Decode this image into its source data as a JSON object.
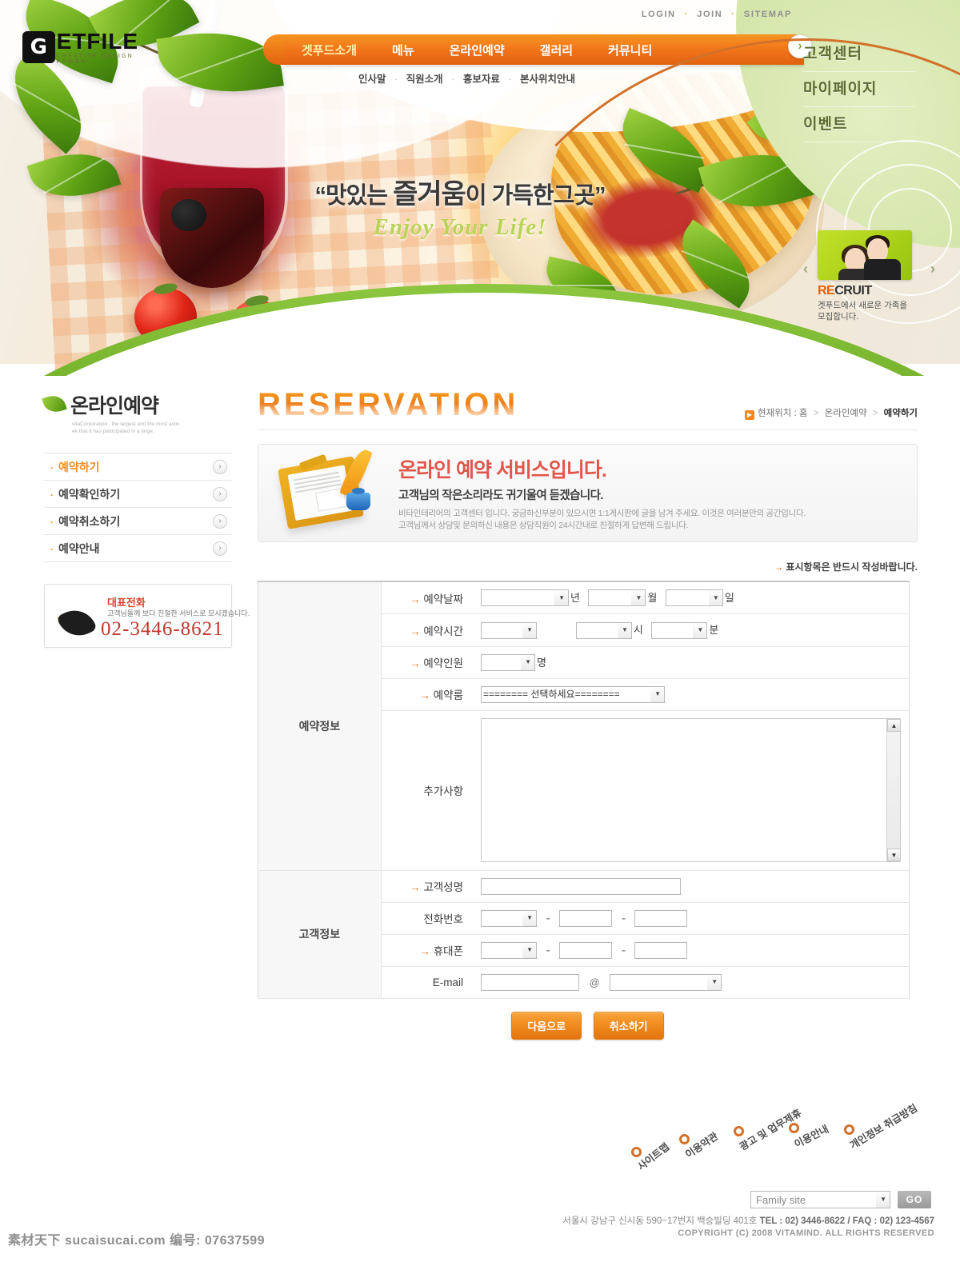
{
  "header": {
    "utility_links": [
      "LOGIN",
      "JOIN",
      "SITEMAP"
    ],
    "logo": {
      "mark": "G",
      "name": "ETFILE",
      "tagline": "CREATIVE DESIGN POWER"
    },
    "nav": [
      {
        "label": "겟푸드소개",
        "active": true
      },
      {
        "label": "메뉴",
        "active": false
      },
      {
        "label": "온라인예약",
        "active": false
      },
      {
        "label": "갤러리",
        "active": false
      },
      {
        "label": "커뮤니티",
        "active": false
      }
    ],
    "nav_arrow": "chevron-right-icon",
    "subnav": [
      "인사말",
      "직원소개",
      "홍보자료",
      "본사위치안내"
    ],
    "green_menu": [
      "고객센터",
      "마이페이지",
      "이벤트"
    ]
  },
  "hero": {
    "slogan_ko_pre": "“맛있는 ",
    "slogan_ko_em": "즐거움",
    "slogan_ko_post": "이 가득한그곳”",
    "slogan_en": "Enjoy Your Life!",
    "recruit": {
      "title_accent": "RE",
      "title_rest": "CRUIT",
      "desc_line1": "겟푸드에서 새로운 가족을",
      "desc_line2": "모집합니다.",
      "prev": "‹",
      "next": "›"
    }
  },
  "sidebar": {
    "title": "온라인예약",
    "subtitle_line1": "vitaCorporation , the largest and the most activ",
    "subtitle_line2": "ek that it has participated in a large.",
    "items": [
      {
        "label": "예약하기",
        "active": true
      },
      {
        "label": "예약확인하기",
        "active": false
      },
      {
        "label": "예약취소하기",
        "active": false
      },
      {
        "label": "예약안내",
        "active": false
      }
    ],
    "phone": {
      "title": "대표전화",
      "desc": "고객님들께 보다 친절한 서비스로 모시겠습니다.",
      "number": "02-3446-8621"
    }
  },
  "main": {
    "page_title": "RESERVATION",
    "breadcrumb": {
      "prefix": "현재위치 :",
      "home": "홈",
      "section": "온라인예약",
      "current": "예약하기",
      "sep": ">"
    },
    "infobox": {
      "heading": "온라인 예약 서비스입니다.",
      "subheading": "고객님의 작은소리라도 귀기울여 듣겠습니다.",
      "para_line1": "비타인테리어의 고객센터 입니다. 궁금하신부분이 있으시면 1:1게시판에 글을 남겨 주세요. 이것은 여러분만의 공간입니다.",
      "para_line2": "고객님께서 상담및 문의하신 내용은 상담직원이 24시간내로 친절하게 답변해 드립니다."
    },
    "required_note": "표시항목은 반드시 작성바랍니다.",
    "form": {
      "group_reservation": "예약정보",
      "group_customer": "고객정보",
      "rows": {
        "date": {
          "label": "예약날짜",
          "required": true,
          "unit_year": "년",
          "unit_month": "월",
          "unit_day": "일",
          "value_year": "",
          "value_month": "",
          "value_day": ""
        },
        "time": {
          "label": "예약시간",
          "required": true,
          "unit_hour": "시",
          "unit_minute": "분",
          "value_ampm": "",
          "value_hour": "",
          "value_minute": ""
        },
        "people": {
          "label": "예약인원",
          "required": true,
          "unit": "명",
          "value": ""
        },
        "room": {
          "label": "예약룸",
          "required": true,
          "value": "======== 선택하세요========"
        },
        "memo": {
          "label": "추가사항",
          "required": false,
          "value": ""
        },
        "name": {
          "label": "고객성명",
          "required": true,
          "value": ""
        },
        "tel": {
          "label": "전화번호",
          "required": false,
          "value_prefix": "",
          "value_mid": "",
          "value_last": "",
          "dash": "-"
        },
        "mobile": {
          "label": "휴대폰",
          "required": true,
          "value_prefix": "",
          "value_mid": "",
          "value_last": "",
          "dash": "-"
        },
        "email": {
          "label": "E-mail",
          "required": false,
          "value_id": "",
          "at": "@",
          "value_domain": ""
        }
      }
    },
    "buttons": {
      "next": "다음으로",
      "cancel": "취소하기"
    }
  },
  "footer": {
    "links": [
      "사이트맵",
      "이용약관",
      "광고 및 업무제휴",
      "이용안내",
      "개인정보 취급방침"
    ],
    "family_site": "Family site",
    "go": "GO",
    "address": "서울시  강남구 신시동 590~17번지  백승빌딩 401호",
    "tel": "TEL : 02) 3446-8622  /  FAQ : 02) 123-4567",
    "copyright": "COPYRIGHT (C) 2008 VITAMIND. ALL RIGHTS RESERVED",
    "watermark": "素材天下 sucaisucai.com  编号: 07637599"
  },
  "colors": {
    "orange": "#f08a1e",
    "orange_dark": "#e2620f",
    "green": "#8dc63f",
    "red_heading": "#e0564b",
    "arc": "#d2712a"
  }
}
